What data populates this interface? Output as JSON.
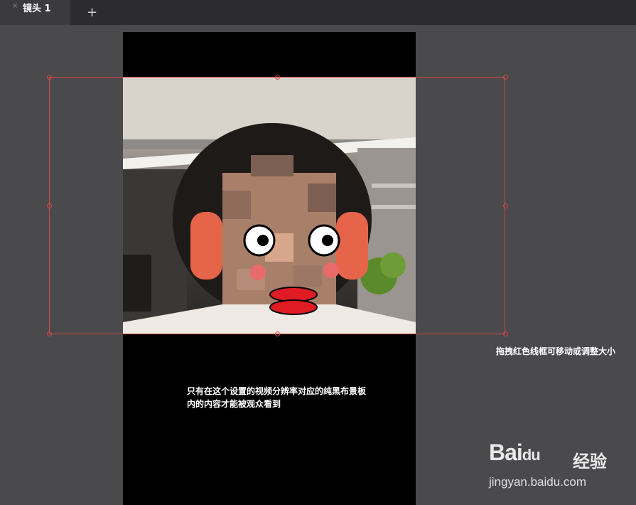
{
  "tabs": [
    {
      "label": "镜头 1",
      "close_icon": "×"
    }
  ],
  "add_tab_icon": "+",
  "hint_text": "拖拽红色线框可移动或调整大小",
  "caption_line1": "只有在这个设置的视频分辨率对应的纯黑布景板",
  "caption_line2": "内的内容才能被观众看到",
  "watermark": {
    "brand": "Bai",
    "brand2": "du",
    "cn": "经验",
    "url": "jingyan.baidu.com"
  },
  "colors": {
    "frame": "#d04a45",
    "background": "#4a494c",
    "canvas": "#000000"
  }
}
